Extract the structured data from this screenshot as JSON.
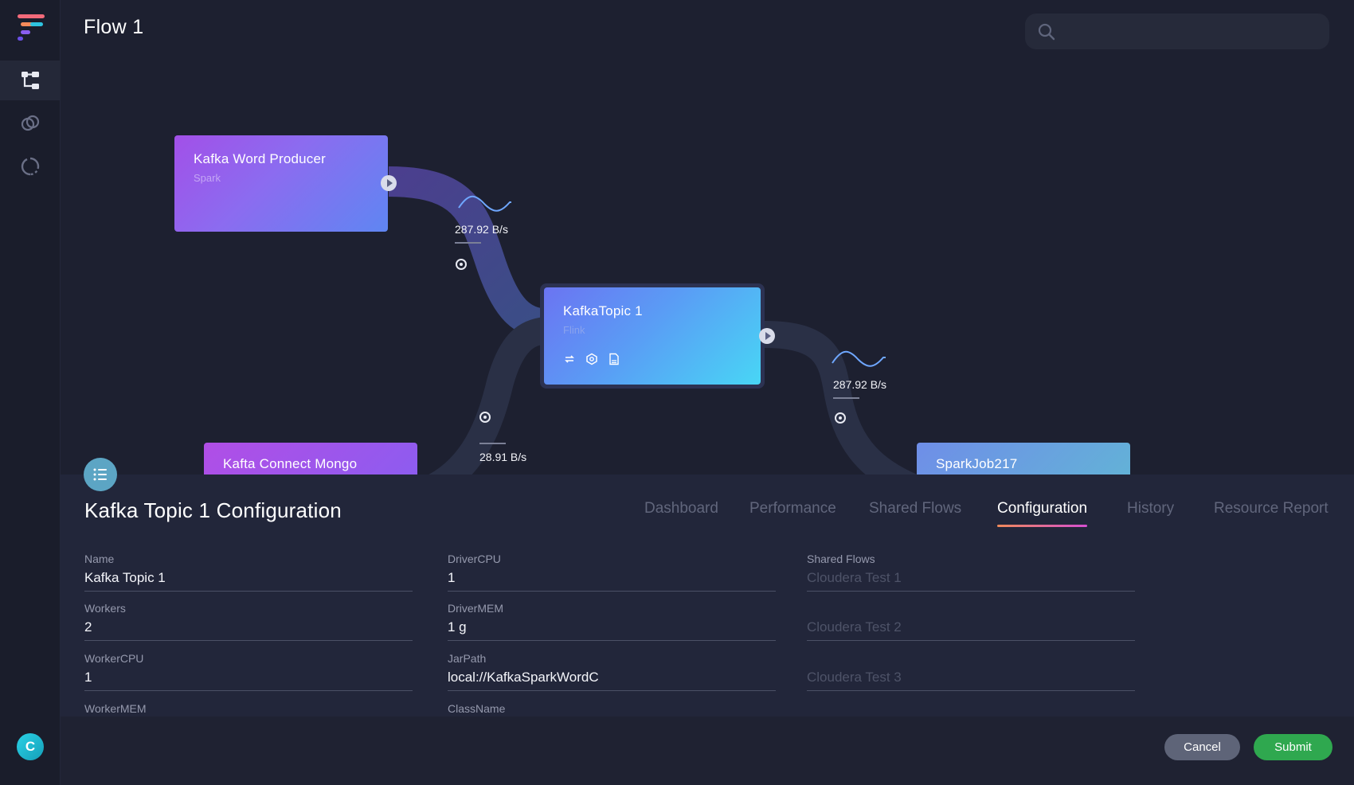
{
  "window": {
    "title": "Flow 1"
  },
  "search": {
    "placeholder": ""
  },
  "sidebar": {
    "items": [
      {
        "icon": "flow-icon",
        "active": true
      },
      {
        "icon": "link-icon",
        "active": false
      },
      {
        "icon": "sync-icon",
        "active": false
      }
    ],
    "avatar_letter": "C"
  },
  "flow": {
    "nodes": [
      {
        "title": "Kafka Word Producer",
        "subtitle": "Spark"
      },
      {
        "title": "KafkaTopic 1",
        "subtitle": "Flink"
      },
      {
        "title": "Kafta Connect Mongo",
        "subtitle": ""
      },
      {
        "title": "SparkJob217",
        "subtitle": ""
      }
    ],
    "rates": [
      "287.92 B/s",
      "28.91 B/s",
      "287.92 B/s"
    ]
  },
  "panel": {
    "title": "Kafka Topic 1 Configuration",
    "tabs": [
      "Dashboard",
      "Performance",
      "Shared Flows",
      "Configuration",
      "History",
      "Resource Report"
    ],
    "active_tab": "Configuration",
    "fields": {
      "name": {
        "label": "Name",
        "value": "Kafka Topic 1"
      },
      "workers": {
        "label": "Workers",
        "value": "2"
      },
      "worker_cpu": {
        "label": "WorkerCPU",
        "value": "1"
      },
      "worker_mem": {
        "label": "WorkerMEM",
        "value": ""
      },
      "driver_cpu": {
        "label": "DriverCPU",
        "value": "1"
      },
      "driver_mem": {
        "label": "DriverMEM",
        "value": "1 g"
      },
      "jar_path": {
        "label": "JarPath",
        "value": "local://KafkaSparkWordC"
      },
      "class_name": {
        "label": "ClassName",
        "value": ""
      },
      "shared_flows": {
        "label": "Shared Flows",
        "values": [
          "Cloudera Test 1",
          "Cloudera Test 2",
          "Cloudera Test 3"
        ]
      }
    },
    "buttons": {
      "cancel": "Cancel",
      "submit": "Submit"
    }
  },
  "colors": {
    "accent_submit": "#2fa84f",
    "background": "#1d2030",
    "tab_underline": "#d64fd1"
  }
}
